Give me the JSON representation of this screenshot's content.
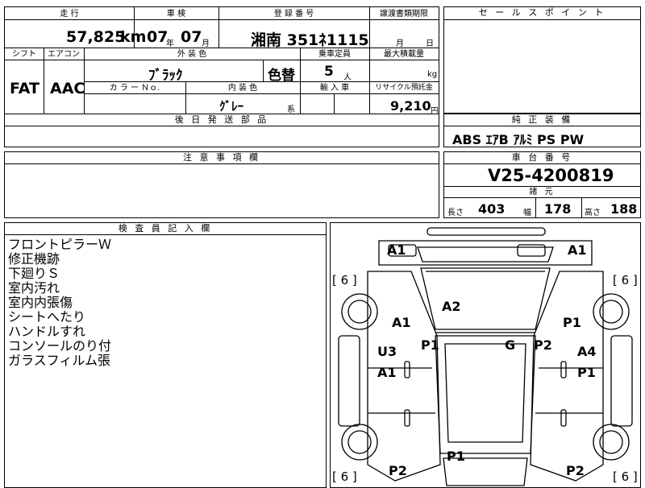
{
  "header": {
    "mileage_label": "走 行",
    "inspection_label": "車 検",
    "registration_label": "登 録 番 号",
    "transfer_label": "譲渡書類期限",
    "sales_point_label": "セ ー ル ス ポ イ ン ト"
  },
  "row1": {
    "mileage": "57,825",
    "mileage_unit": "km",
    "insp_year": "07",
    "year_unit": "年",
    "insp_month": "07",
    "month_unit": "月",
    "plate": "湘南 351ﾈ1115",
    "transfer_month_unit": "月",
    "transfer_day_unit": "日"
  },
  "row2_labels": {
    "shift": "シフト",
    "aircon": "エアコン",
    "exterior": "外 装 色",
    "capacity": "乗車定員",
    "max_load": "最大積載量"
  },
  "row2": {
    "shift": "FAT",
    "aircon": "AAC",
    "exterior_color": "ﾌﾞﾗｯｸ",
    "repaint": "色替",
    "capacity": "5",
    "capacity_unit": "人",
    "load_unit": "kg"
  },
  "row3_labels": {
    "color_no": "カ ラ ー Ｎｏ.",
    "interior": "内 装 色",
    "import": "輸 入 車",
    "recycle": "リサイクル預託金"
  },
  "row3": {
    "interior_color": "ｸﾞﾚｰ",
    "interior_suffix": "系",
    "recycle_fee": "9,210",
    "recycle_unit": "円"
  },
  "later_parts_label": "後 日 発 送 部 品",
  "equipment": {
    "label": "純 正 装 備",
    "items": "ABS ｴｱB ｱﾙﾐ PS PW"
  },
  "caution_label": "注 意 事 項 欄",
  "chassis": {
    "label": "車 台 番 号",
    "number": "V25-4200819",
    "spec_label": "諸 元",
    "length_label": "長さ",
    "length": "403",
    "width_label": "幅",
    "width": "178",
    "height_label": "高さ",
    "height": "188"
  },
  "inspector": {
    "label": "検 査 員 記 入 欄",
    "notes": [
      "フロントピラーＷ",
      "修正機跡",
      "下廻りＳ",
      "室内汚れ",
      "室内内張傷",
      "シートへたり",
      "ハンドルすれ",
      "コンソールのり付",
      "ガラスフィルム張"
    ]
  },
  "diagram": {
    "marks": [
      "A1",
      "A1",
      "A2",
      "A1",
      "P1",
      "P1",
      "G",
      "P2",
      "U3",
      "A4",
      "A1",
      "P1",
      "P1",
      "P2",
      "P2"
    ],
    "tires": [
      "[ 6 ]",
      "[ 6 ]",
      "[ 6 ]",
      "[ 6 ]"
    ]
  }
}
